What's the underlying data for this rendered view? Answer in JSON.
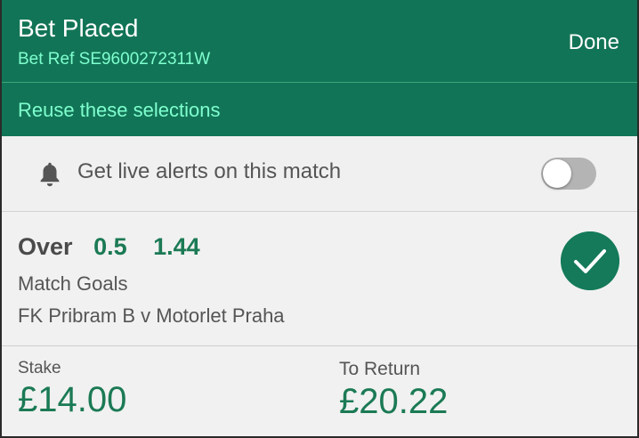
{
  "header": {
    "title": "Bet Placed",
    "bet_ref": "Bet Ref SE9600272311W",
    "done_label": "Done"
  },
  "reuse": {
    "label": "Reuse these selections"
  },
  "alerts": {
    "icon": "bell-icon",
    "label": "Get live alerts on this match",
    "toggle_on": false
  },
  "selection": {
    "name": "Over",
    "handicap": "0.5",
    "odds": "1.44",
    "market": "Match Goals",
    "event": "FK Pribram B v Motorlet Praha",
    "status_icon": "check-circle-icon"
  },
  "amounts": {
    "stake_label": "Stake",
    "stake_value": "£14.00",
    "return_label": "To Return",
    "return_value": "£20.22"
  },
  "colors": {
    "brand_green": "#127456",
    "accent_mint": "#7fffcf",
    "value_green": "#1b7a55",
    "background": "#f1f1f1"
  }
}
